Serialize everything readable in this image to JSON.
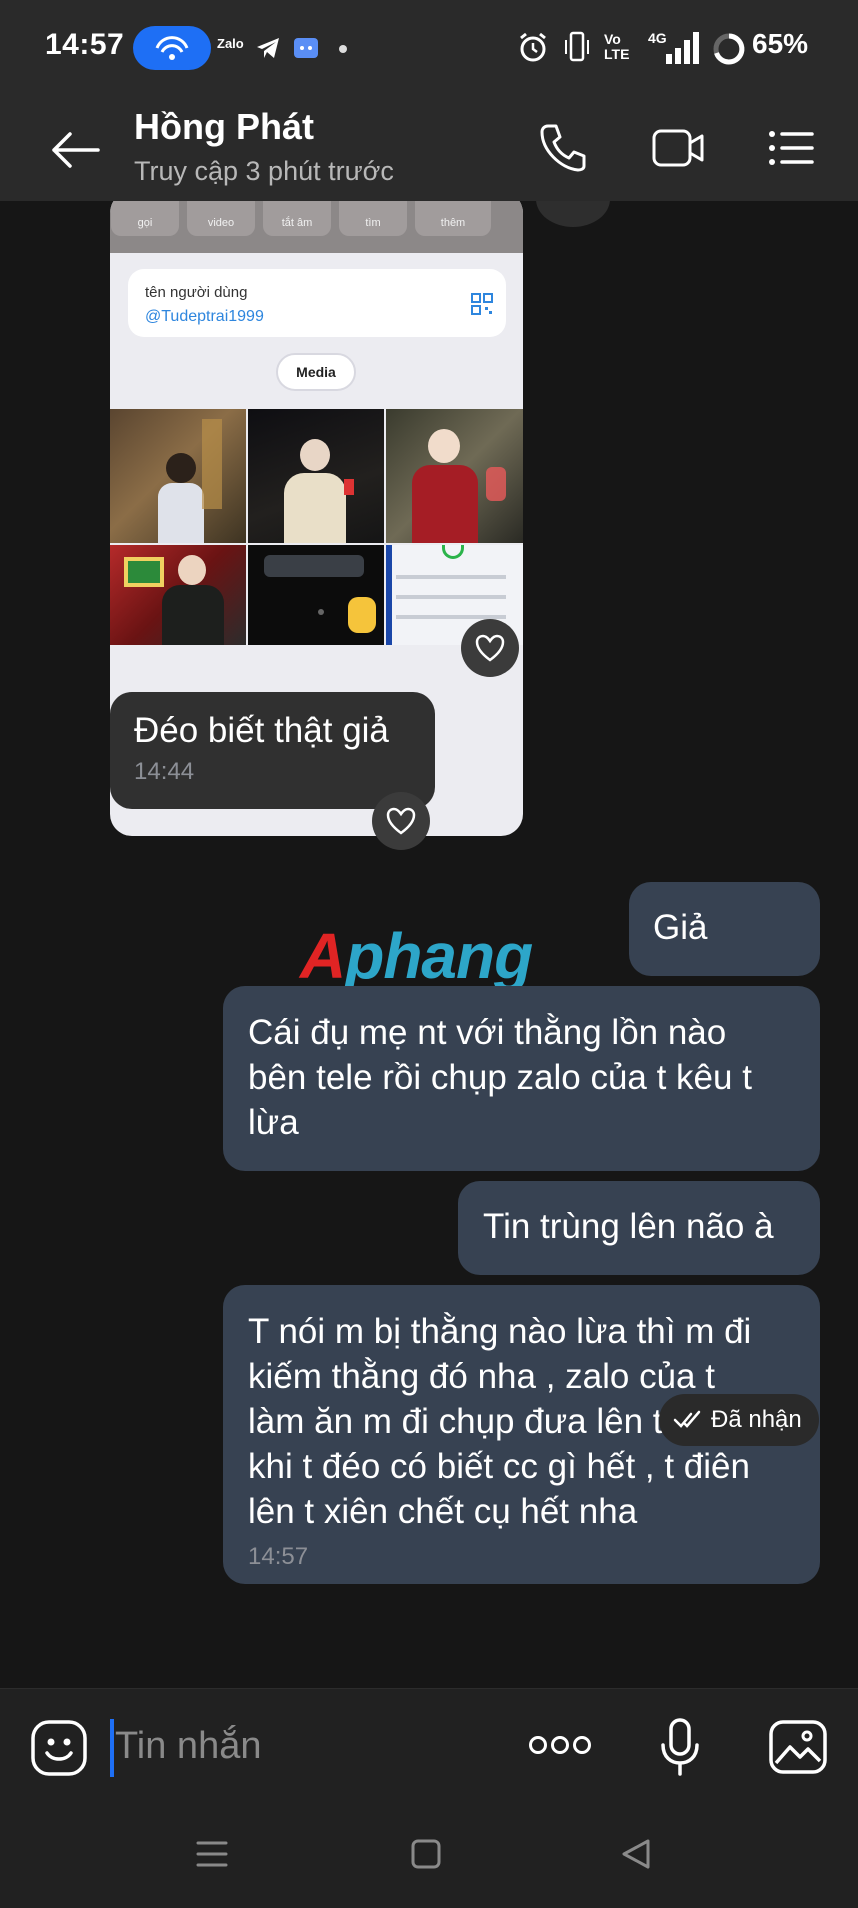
{
  "status_bar": {
    "time": "14:57",
    "app_icons": [
      "Zalo"
    ],
    "network": "4G",
    "volte": "Vo LTE",
    "battery": "65%"
  },
  "header": {
    "contact_name": "Hồng Phát",
    "contact_status": "Truy cập 3 phút trước"
  },
  "shared_image": {
    "top_buttons": [
      "gọi",
      "video",
      "tắt âm",
      "tìm",
      "thêm"
    ],
    "card_label": "tên người dùng",
    "card_handle": "@Tudeptrai1999",
    "media_label": "Media"
  },
  "messages": [
    {
      "direction": "in",
      "text": "Đéo biết thật giả",
      "time": "14:44"
    },
    {
      "direction": "out",
      "text": "Giả"
    },
    {
      "direction": "out",
      "lines": [
        "Cái đụ mẹ nt với thằng lồn nào",
        "bên tele rồi chụp zalo của t kêu t",
        "lừa"
      ]
    },
    {
      "direction": "out",
      "text": "Tin trùng lên não à"
    },
    {
      "direction": "out",
      "lines": [
        "T nói m bị thằng nào lừa thì m đi",
        "kiếm thằng đó nha , zalo của t",
        "làm ăn m đi chụp đưa lên trong",
        "khi t đéo có biết cc gì hết , t điên",
        "lên t xiên chết cụ hết nha"
      ],
      "time": "14:57"
    }
  ],
  "receipt": "Đã nhận",
  "watermark": "Aphang",
  "input": {
    "placeholder": "Tin nhắn"
  },
  "colors": {
    "background": "#161616",
    "header": "#2a2a2a",
    "bubble_in": "#303030",
    "bubble_out": "#374252",
    "accent": "#1e6ff5"
  }
}
